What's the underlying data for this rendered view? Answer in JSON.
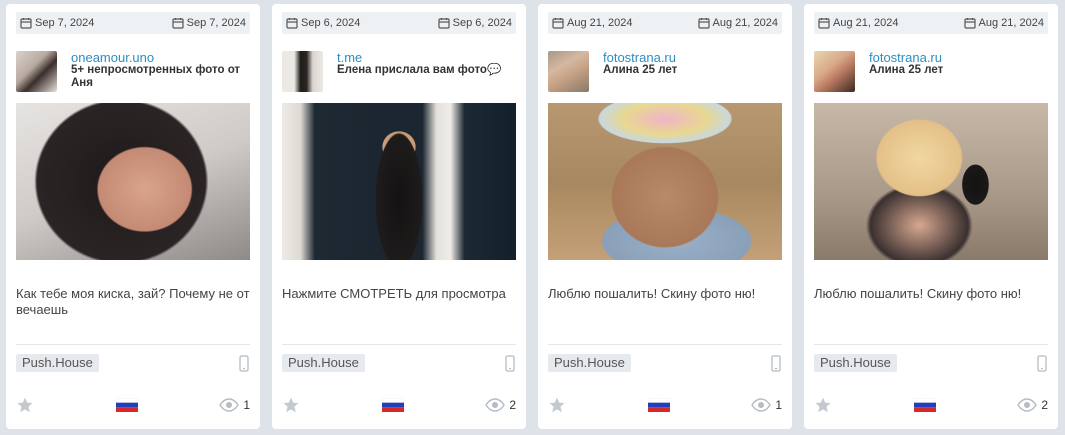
{
  "cards": [
    {
      "date_left": "Sep 7, 2024",
      "date_right": "Sep 7, 2024",
      "site": "oneamour.uno",
      "subtitle": "5+ непросмотренных фото от Аня",
      "message": "Как тебе моя киска, зай?  Почему не отвечаешь",
      "network": "Push.House",
      "views": "1"
    },
    {
      "date_left": "Sep 6, 2024",
      "date_right": "Sep 6, 2024",
      "site": "t.me",
      "subtitle": "Елена прислала вам фото💬",
      "message": "Нажмите СМОТРЕТЬ для просмотра",
      "network": "Push.House",
      "views": "2"
    },
    {
      "date_left": "Aug 21, 2024",
      "date_right": "Aug 21, 2024",
      "site": "fotostrana.ru",
      "subtitle": "Алина 25 лет",
      "message": "Люблю пошалить! Скину фото ню!",
      "network": "Push.House",
      "views": "1"
    },
    {
      "date_left": "Aug 21, 2024",
      "date_right": "Aug 21, 2024",
      "site": "fotostrana.ru",
      "subtitle": "Алина 25 лет",
      "message": "Люблю пошалить! Скину фото ню!",
      "network": "Push.House",
      "views": "2"
    }
  ],
  "icons": {
    "date": "calendar-icon",
    "device": "mobile-phone-icon",
    "favorite": "star-icon",
    "country": "russia-flag-icon",
    "views": "eye-icon"
  },
  "colors": {
    "background": "#dde3e8",
    "card": "#ffffff",
    "site_link": "#2b8ec4",
    "badge": "#e6eaee",
    "icon_gray": "#b5bcc3"
  }
}
